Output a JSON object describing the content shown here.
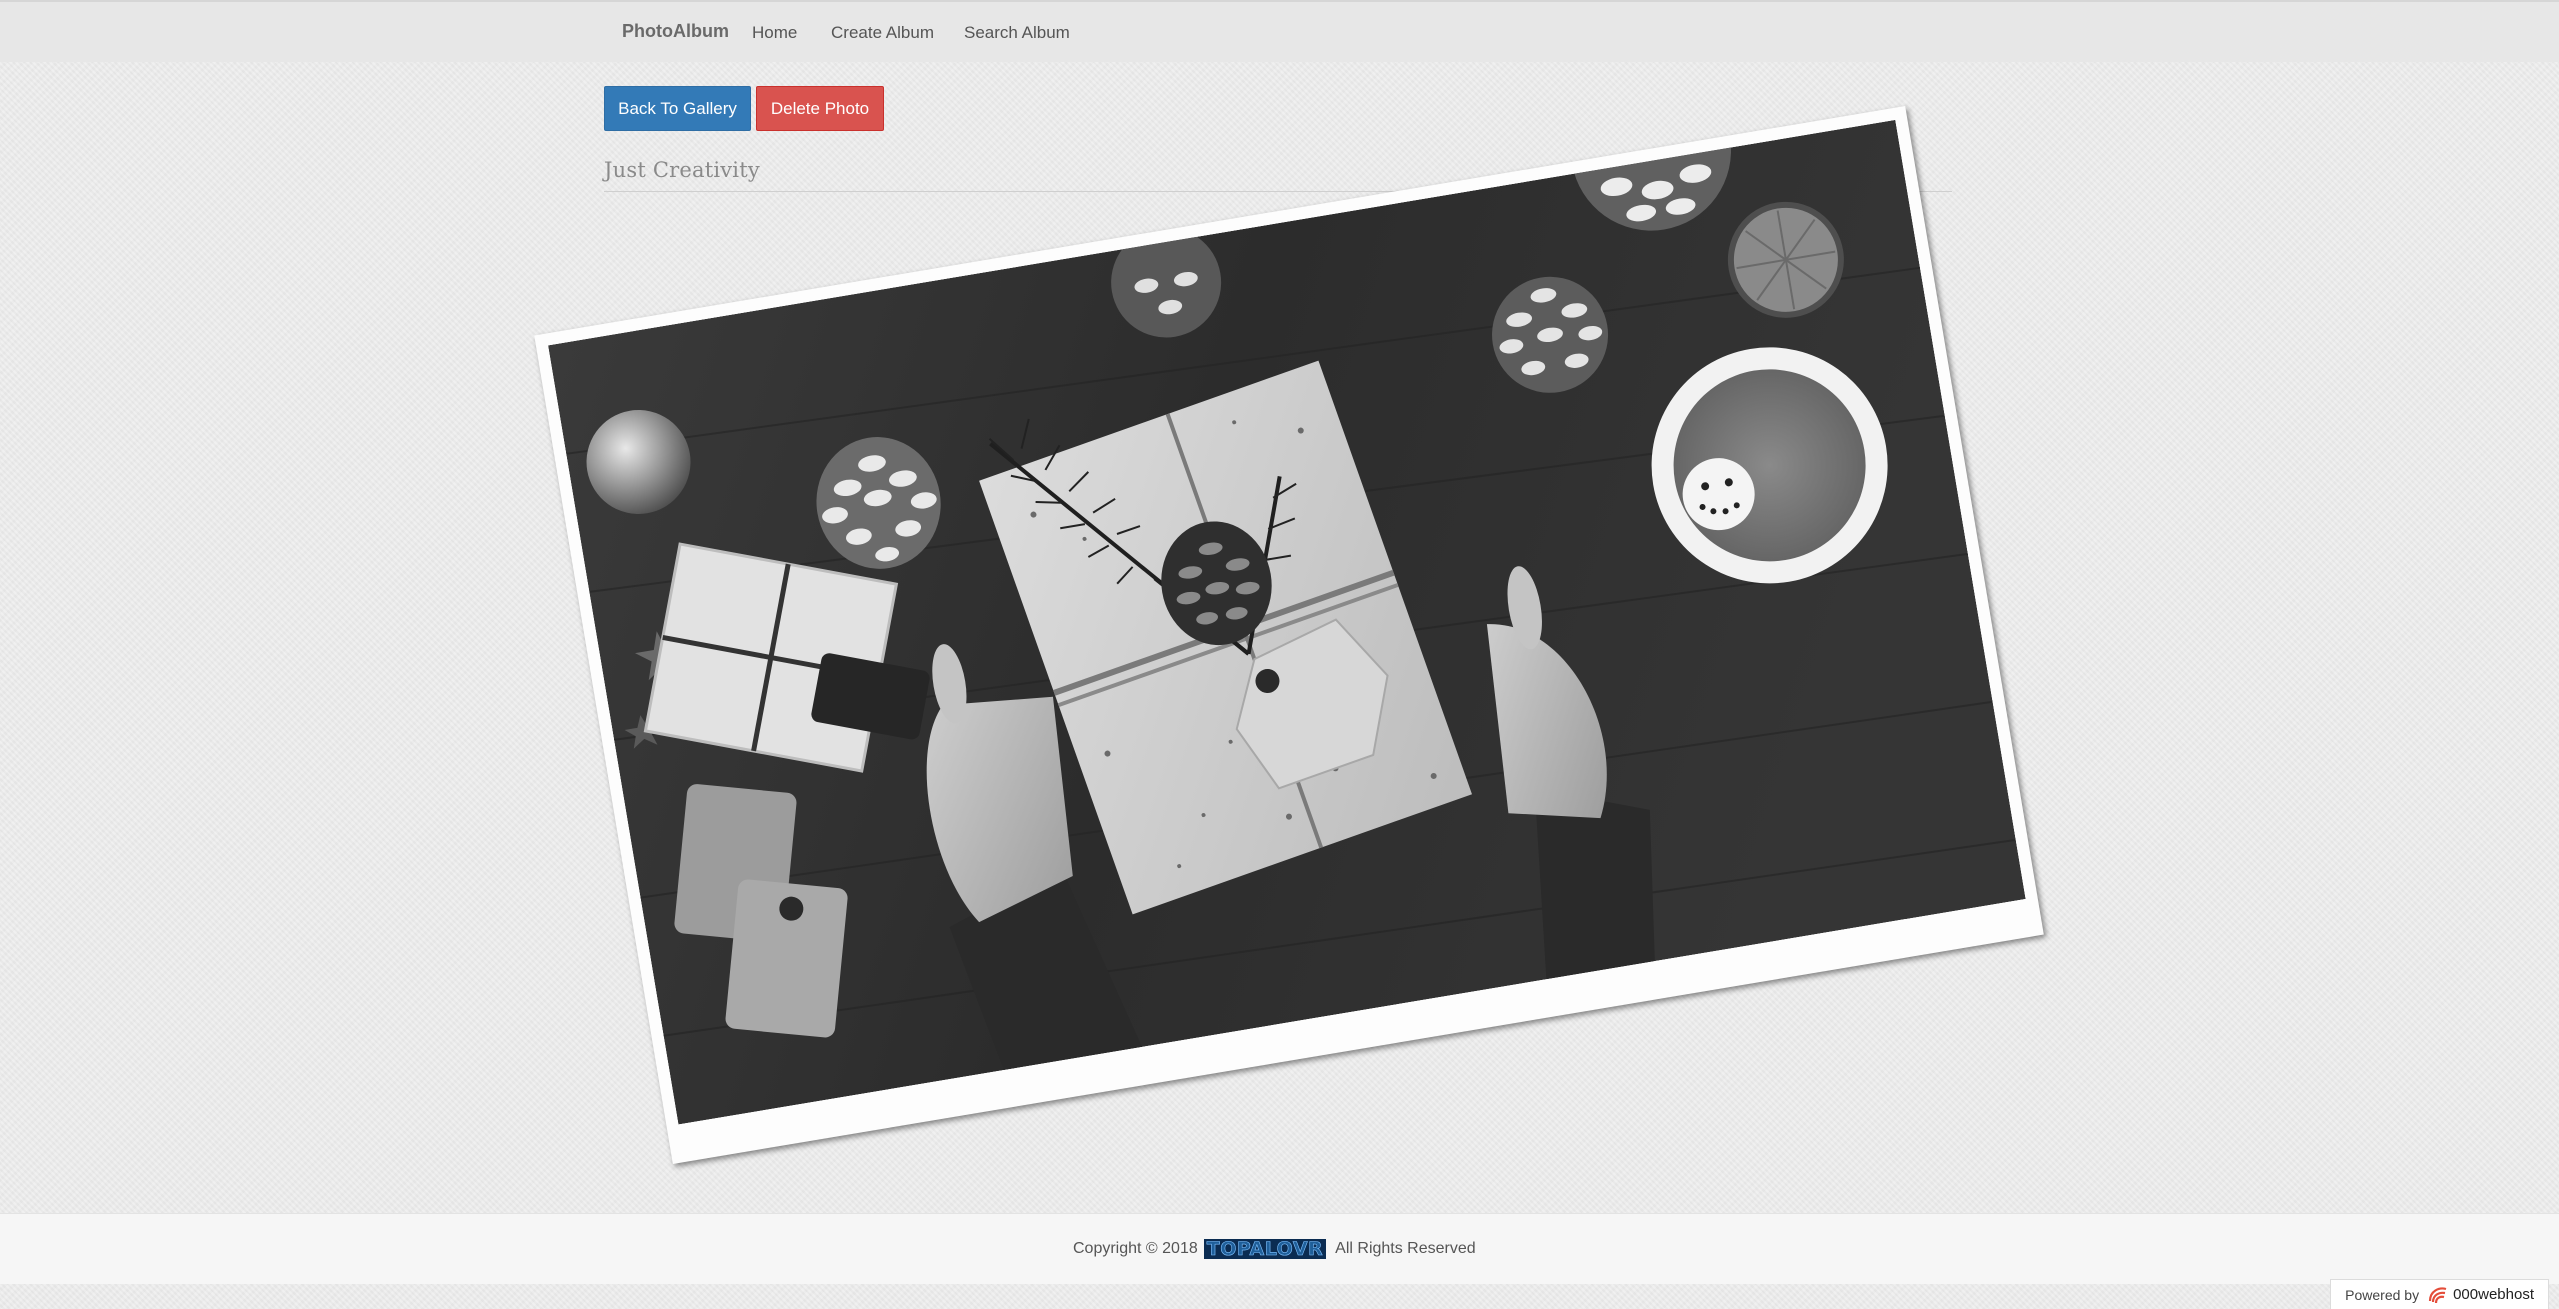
{
  "navbar": {
    "brand": "PhotoAlbum",
    "links": [
      {
        "label": "Home"
      },
      {
        "label": "Create Album"
      },
      {
        "label": "Search Album"
      }
    ]
  },
  "actions": {
    "back_label": "Back To Gallery",
    "delete_label": "Delete Photo",
    "back_color": "#337ab7",
    "delete_color": "#d9534f"
  },
  "album": {
    "title": "Just Creativity"
  },
  "photo": {
    "description": "Black and white photo of hands holding a wrapped gift with pine cones, tags and a mug"
  },
  "footer": {
    "copyright": "Copyright © 2018",
    "logo_text": "TOPALOVR",
    "rights": "All Rights Reserved"
  },
  "powered_badge": {
    "label": "Powered by",
    "brand": "000webhost",
    "icon": "000webhost-logo-icon"
  }
}
